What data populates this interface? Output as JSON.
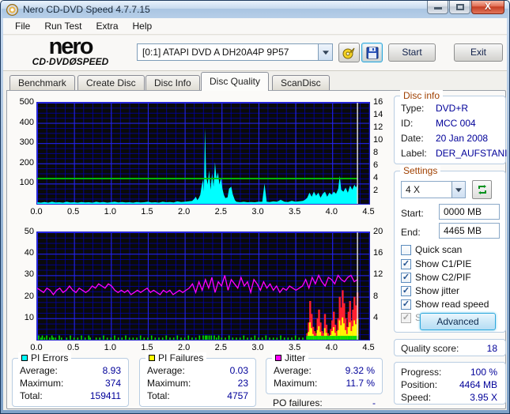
{
  "window": {
    "title": "Nero CD-DVD Speed 4.7.7.15"
  },
  "menu": {
    "items": [
      "File",
      "Run Test",
      "Extra",
      "Help"
    ]
  },
  "toolbar": {
    "logo_line1": "nero",
    "logo_line2": "CD·DVDØSPEED",
    "drive_selector": "[0:1]  ATAPI DVD A  DH20A4P 9P57",
    "start_label": "Start",
    "exit_label": "Exit"
  },
  "tabs": {
    "items": [
      "Benchmark",
      "Create Disc",
      "Disc Info",
      "Disc Quality",
      "ScanDisc"
    ],
    "active": "Disc Quality"
  },
  "disc_info": {
    "title": "Disc info",
    "rows": [
      [
        "Type:",
        "DVD+R"
      ],
      [
        "ID:",
        "MCC 004"
      ],
      [
        "Date:",
        "20 Jan 2008"
      ],
      [
        "Label:",
        "DER_AUFSTANI"
      ]
    ]
  },
  "settings": {
    "title": "Settings",
    "speed_value": "4 X",
    "start_label": "Start:",
    "start_value": "0000 MB",
    "end_label": "End:",
    "end_value": "4465 MB",
    "checkboxes": [
      {
        "label": "Quick scan",
        "checked": false,
        "disabled": false
      },
      {
        "label": "Show C1/PIE",
        "checked": true,
        "disabled": false
      },
      {
        "label": "Show C2/PIF",
        "checked": true,
        "disabled": false
      },
      {
        "label": "Show jitter",
        "checked": true,
        "disabled": false
      },
      {
        "label": "Show read speed",
        "checked": true,
        "disabled": false
      },
      {
        "label": "Show write speed",
        "checked": true,
        "disabled": true
      }
    ],
    "advanced_label": "Advanced"
  },
  "quality": {
    "label": "Quality score:",
    "value": "18"
  },
  "progress": {
    "rows": [
      [
        "Progress:",
        "100 %"
      ],
      [
        "Position:",
        "4464 MB"
      ],
      [
        "Speed:",
        "3.95 X"
      ]
    ]
  },
  "stats": {
    "pi_errors": {
      "title": "PI Errors",
      "color": "#00ffff",
      "rows": [
        [
          "Average:",
          "8.93"
        ],
        [
          "Maximum:",
          "374"
        ],
        [
          "Total:",
          "159411"
        ]
      ]
    },
    "pi_failures": {
      "title": "PI Failures",
      "color": "#ffff00",
      "rows": [
        [
          "Average:",
          "0.03"
        ],
        [
          "Maximum:",
          "23"
        ],
        [
          "Total:",
          "4757"
        ]
      ]
    },
    "jitter": {
      "title": "Jitter",
      "color": "#ff00ff",
      "rows": [
        [
          "Average:",
          "9.32 %"
        ],
        [
          "Maximum:",
          "11.7 %"
        ]
      ],
      "po_label": "PO failures:",
      "po_value": "-"
    }
  },
  "colors": {
    "pie": "#00ffff",
    "read_speed": "#00cc00",
    "jitter": "#ff00ff",
    "pif_low": "#00e000",
    "pif_mid": "#ffff00",
    "pif_high": "#ff2030",
    "marker": "#dcdcdc",
    "grid": "#0000c8",
    "plot_bg": "#0a0a0a"
  },
  "chart_data": [
    {
      "type": "area",
      "series_names": [
        "PI Errors",
        "Read speed"
      ],
      "x_max": 4.5,
      "x_ticks": [
        "0.0",
        "0.5",
        "1.0",
        "1.5",
        "2.0",
        "2.5",
        "3.0",
        "3.5",
        "4.0",
        "4.5"
      ],
      "left_ticks": [
        500,
        400,
        300,
        200,
        100
      ],
      "left_max": 500,
      "right_ticks": [
        16,
        14,
        12,
        10,
        8,
        6,
        4,
        2
      ],
      "right_max": 16,
      "read_speed_value": 4,
      "marker_x": 4.34,
      "area": [
        [
          0,
          8
        ],
        [
          0.05,
          6
        ],
        [
          0.1,
          9
        ],
        [
          0.15,
          6
        ],
        [
          0.2,
          10
        ],
        [
          0.25,
          7
        ],
        [
          0.3,
          8
        ],
        [
          0.35,
          6
        ],
        [
          0.4,
          10
        ],
        [
          0.45,
          7
        ],
        [
          0.5,
          8
        ],
        [
          0.55,
          6
        ],
        [
          0.6,
          9
        ],
        [
          0.65,
          7
        ],
        [
          0.7,
          8
        ],
        [
          0.75,
          6
        ],
        [
          0.8,
          10
        ],
        [
          0.85,
          7
        ],
        [
          0.9,
          9
        ],
        [
          0.95,
          6
        ],
        [
          1.0,
          8
        ],
        [
          1.05,
          10
        ],
        [
          1.1,
          7
        ],
        [
          1.15,
          9
        ],
        [
          1.2,
          7
        ],
        [
          1.25,
          8
        ],
        [
          1.3,
          6
        ],
        [
          1.35,
          9
        ],
        [
          1.4,
          7
        ],
        [
          1.45,
          8
        ],
        [
          1.5,
          10
        ],
        [
          1.55,
          7
        ],
        [
          1.6,
          8
        ],
        [
          1.65,
          6
        ],
        [
          1.7,
          10
        ],
        [
          1.75,
          8
        ],
        [
          1.8,
          9
        ],
        [
          1.85,
          7
        ],
        [
          1.9,
          12
        ],
        [
          1.95,
          9
        ],
        [
          2.0,
          10
        ],
        [
          2.05,
          12
        ],
        [
          2.1,
          15
        ],
        [
          2.13,
          25
        ],
        [
          2.15,
          35
        ],
        [
          2.17,
          18
        ],
        [
          2.19,
          28
        ],
        [
          2.21,
          45
        ],
        [
          2.23,
          90
        ],
        [
          2.25,
          120
        ],
        [
          2.26,
          60
        ],
        [
          2.275,
          375
        ],
        [
          2.29,
          140
        ],
        [
          2.31,
          95
        ],
        [
          2.33,
          165
        ],
        [
          2.35,
          70
        ],
        [
          2.37,
          150
        ],
        [
          2.39,
          85
        ],
        [
          2.41,
          205
        ],
        [
          2.43,
          125
        ],
        [
          2.45,
          155
        ],
        [
          2.47,
          95
        ],
        [
          2.49,
          130
        ],
        [
          2.51,
          75
        ],
        [
          2.53,
          45
        ],
        [
          2.55,
          28
        ],
        [
          2.58,
          32
        ],
        [
          2.6,
          75
        ],
        [
          2.63,
          85
        ],
        [
          2.65,
          48
        ],
        [
          2.68,
          18
        ],
        [
          2.7,
          10
        ],
        [
          2.75,
          8
        ],
        [
          2.8,
          10
        ],
        [
          2.85,
          8
        ],
        [
          2.9,
          9
        ],
        [
          2.95,
          8
        ],
        [
          3.0,
          10
        ],
        [
          3.05,
          10
        ],
        [
          3.08,
          100
        ],
        [
          3.11,
          10
        ],
        [
          3.15,
          9
        ],
        [
          3.2,
          12
        ],
        [
          3.25,
          10
        ],
        [
          3.3,
          20
        ],
        [
          3.35,
          10
        ],
        [
          3.4,
          9
        ],
        [
          3.45,
          15
        ],
        [
          3.5,
          10
        ],
        [
          3.55,
          12
        ],
        [
          3.6,
          15
        ],
        [
          3.63,
          20
        ],
        [
          3.66,
          30
        ],
        [
          3.69,
          55
        ],
        [
          3.72,
          35
        ],
        [
          3.75,
          60
        ],
        [
          3.78,
          40
        ],
        [
          3.81,
          55
        ],
        [
          3.84,
          30
        ],
        [
          3.87,
          50
        ],
        [
          3.9,
          60
        ],
        [
          3.93,
          35
        ],
        [
          3.96,
          55
        ],
        [
          3.99,
          45
        ],
        [
          4.02,
          60
        ],
        [
          4.05,
          50
        ],
        [
          4.08,
          75
        ],
        [
          4.1,
          140
        ],
        [
          4.12,
          70
        ],
        [
          4.15,
          60
        ],
        [
          4.18,
          80
        ],
        [
          4.21,
          55
        ],
        [
          4.24,
          90
        ],
        [
          4.27,
          70
        ],
        [
          4.3,
          95
        ],
        [
          4.32,
          80
        ],
        [
          4.34,
          100
        ]
      ]
    },
    {
      "type": "bars+line",
      "series_names": [
        "PI Failures",
        "Jitter"
      ],
      "x_max": 4.5,
      "x_ticks": [
        "0.0",
        "0.5",
        "1.0",
        "1.5",
        "2.0",
        "2.5",
        "3.0",
        "3.5",
        "4.0",
        "4.5"
      ],
      "left_ticks": [
        50,
        40,
        30,
        20,
        10
      ],
      "left_max": 50,
      "right_ticks": [
        20,
        16,
        12,
        8,
        4
      ],
      "right_max": 20,
      "marker_x": 4.34,
      "green_bars": [
        [
          0.02,
          2
        ],
        [
          0.05,
          1
        ],
        [
          0.07,
          2
        ],
        [
          0.1,
          1
        ],
        [
          0.13,
          2
        ],
        [
          0.17,
          1
        ],
        [
          0.2,
          2
        ],
        [
          0.22,
          1
        ],
        [
          0.25,
          1
        ],
        [
          0.3,
          2
        ],
        [
          0.33,
          1
        ],
        [
          0.4,
          1
        ],
        [
          0.45,
          2
        ],
        [
          0.5,
          1
        ],
        [
          0.55,
          1
        ],
        [
          0.6,
          2
        ],
        [
          0.65,
          1
        ],
        [
          0.7,
          2
        ],
        [
          0.72,
          1
        ],
        [
          0.8,
          1
        ],
        [
          0.85,
          1
        ],
        [
          0.9,
          2
        ],
        [
          0.95,
          1
        ],
        [
          1.0,
          1
        ],
        [
          1.05,
          2
        ],
        [
          1.1,
          1
        ],
        [
          1.15,
          1
        ],
        [
          1.2,
          2
        ],
        [
          1.25,
          1
        ],
        [
          1.3,
          1
        ],
        [
          1.35,
          1
        ],
        [
          1.4,
          2
        ],
        [
          1.45,
          1
        ],
        [
          1.5,
          1
        ],
        [
          1.55,
          2
        ],
        [
          1.6,
          1
        ],
        [
          1.65,
          1
        ],
        [
          1.7,
          1
        ],
        [
          1.75,
          2
        ],
        [
          1.8,
          1
        ],
        [
          1.85,
          1
        ],
        [
          1.9,
          2
        ],
        [
          1.95,
          1
        ],
        [
          2.0,
          1
        ],
        [
          2.05,
          2
        ],
        [
          2.1,
          1
        ],
        [
          2.15,
          1
        ],
        [
          2.2,
          2
        ],
        [
          2.25,
          2
        ],
        [
          2.28,
          2
        ],
        [
          2.3,
          2
        ],
        [
          2.33,
          2
        ],
        [
          2.36,
          2
        ],
        [
          2.4,
          2
        ],
        [
          2.43,
          1
        ],
        [
          2.46,
          2
        ],
        [
          2.5,
          1
        ],
        [
          2.55,
          1
        ],
        [
          2.6,
          2
        ],
        [
          2.65,
          1
        ],
        [
          2.7,
          1
        ],
        [
          2.75,
          1
        ],
        [
          2.8,
          2
        ],
        [
          2.85,
          1
        ],
        [
          2.9,
          1
        ],
        [
          2.95,
          2
        ],
        [
          3.0,
          1
        ],
        [
          3.05,
          1
        ],
        [
          3.1,
          2
        ],
        [
          3.15,
          1
        ],
        [
          3.2,
          1
        ],
        [
          3.25,
          1
        ],
        [
          3.3,
          2
        ],
        [
          3.35,
          1
        ],
        [
          3.4,
          1
        ],
        [
          3.45,
          1
        ],
        [
          3.5,
          2
        ],
        [
          3.55,
          1
        ],
        [
          3.6,
          1
        ]
      ],
      "spike_bars": [
        [
          3.66,
          3
        ],
        [
          3.68,
          8
        ],
        [
          3.7,
          18
        ],
        [
          3.72,
          12
        ],
        [
          3.74,
          6
        ],
        [
          3.76,
          4
        ],
        [
          3.78,
          3
        ],
        [
          3.8,
          10
        ],
        [
          3.82,
          14
        ],
        [
          3.84,
          8
        ],
        [
          3.86,
          4
        ],
        [
          3.88,
          3
        ],
        [
          3.9,
          12
        ],
        [
          3.92,
          7
        ],
        [
          3.94,
          3
        ],
        [
          3.96,
          2
        ],
        [
          3.98,
          5
        ],
        [
          4.0,
          9
        ],
        [
          4.02,
          13
        ],
        [
          4.04,
          7
        ],
        [
          4.06,
          4
        ],
        [
          4.08,
          10
        ],
        [
          4.1,
          20
        ],
        [
          4.12,
          15
        ],
        [
          4.14,
          23
        ],
        [
          4.16,
          17
        ],
        [
          4.18,
          10
        ],
        [
          4.2,
          6
        ],
        [
          4.22,
          13
        ],
        [
          4.24,
          18
        ],
        [
          4.26,
          9
        ],
        [
          4.28,
          14
        ],
        [
          4.3,
          20
        ],
        [
          4.32,
          16
        ],
        [
          4.34,
          22
        ]
      ],
      "jitter": {
        "x_start": 0,
        "x_step": 0.04384,
        "values": [
          24,
          23,
          22,
          24,
          23,
          21,
          23,
          24,
          22,
          23,
          25,
          23,
          22,
          24,
          23,
          22,
          23,
          25,
          24,
          26,
          25,
          24,
          26,
          25,
          23,
          22,
          23,
          22,
          23,
          21,
          22,
          23,
          22,
          23,
          24,
          22,
          23,
          22,
          21,
          23,
          22,
          23,
          21,
          22,
          23,
          22,
          23,
          24,
          26,
          22,
          27,
          23,
          28,
          24,
          29,
          22,
          27,
          25,
          30,
          23,
          28,
          26,
          24,
          29,
          25,
          27,
          22,
          28,
          26,
          23,
          27,
          24,
          26,
          23,
          25,
          22,
          24,
          23,
          25,
          24,
          23,
          24,
          25,
          28,
          24,
          29,
          26,
          30,
          27,
          25,
          29,
          28,
          26,
          30,
          28,
          27,
          29,
          30,
          27,
          28
        ]
      }
    }
  ]
}
